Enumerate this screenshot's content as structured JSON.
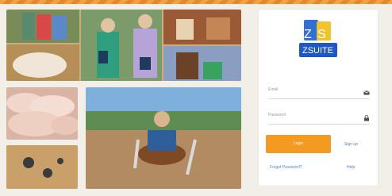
{
  "login": {
    "email_label": "Email",
    "password_label": "Password",
    "login_button": "Login",
    "signup_link": "Sign up",
    "forgot_password_link": "Forgot Password?",
    "help_link": "Help"
  },
  "logo": {
    "monogram": "ZS",
    "wordmark": "ZSUITE"
  },
  "colors": {
    "accent": "#f39a22",
    "brand_blue": "#2f6fd8",
    "brand_yellow": "#f3c32b"
  },
  "icons": {
    "email": "envelope-icon",
    "password": "lock-icon"
  }
}
